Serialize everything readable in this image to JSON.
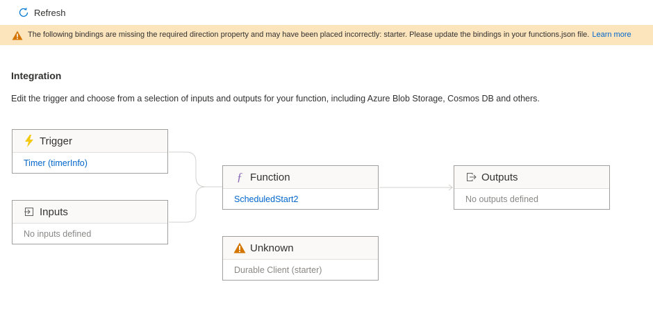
{
  "toolbar": {
    "refresh_label": "Refresh"
  },
  "banner": {
    "message": "The following bindings are missing the required direction property and may have been placed incorrectly: starter. Please update the bindings in your functions.json file.",
    "link_text": "Learn more",
    "color": "#fce4bc"
  },
  "page": {
    "title": "Integration",
    "description": "Edit the trigger and choose from a selection of inputs and outputs for your function, including Azure Blob Storage, Cosmos DB and others."
  },
  "cards": {
    "trigger": {
      "title": "Trigger",
      "value": "Timer (timerInfo)",
      "icon": "lightning-icon"
    },
    "inputs": {
      "title": "Inputs",
      "value": "No inputs defined",
      "icon": "input-icon"
    },
    "function": {
      "title": "Function",
      "value": "ScheduledStart2",
      "icon": "function-icon"
    },
    "outputs": {
      "title": "Outputs",
      "value": "No outputs defined",
      "icon": "output-icon"
    },
    "unknown": {
      "title": "Unknown",
      "value": "Durable Client (starter)",
      "icon": "warning-icon"
    }
  },
  "colors": {
    "link": "#0066cc",
    "warning": "#d47500",
    "accent": "#0078d4"
  }
}
